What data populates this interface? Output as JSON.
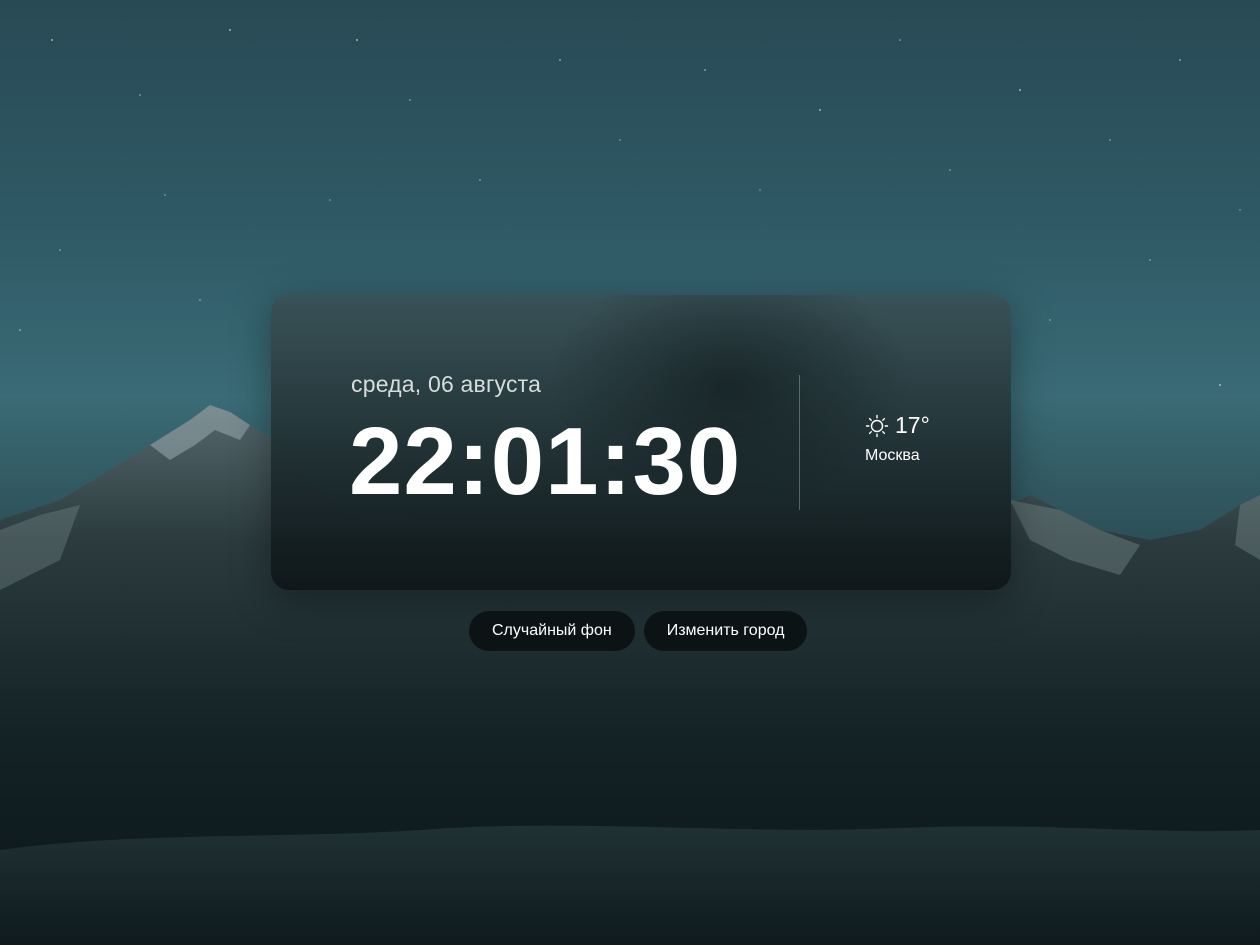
{
  "clock": {
    "date": "среда, 06 августа",
    "time": "22:01:30"
  },
  "weather": {
    "icon": "sun-icon",
    "temperature": "17°",
    "city": "Москва"
  },
  "buttons": {
    "random_background": "Случайный фон",
    "change_city": "Изменить город"
  }
}
